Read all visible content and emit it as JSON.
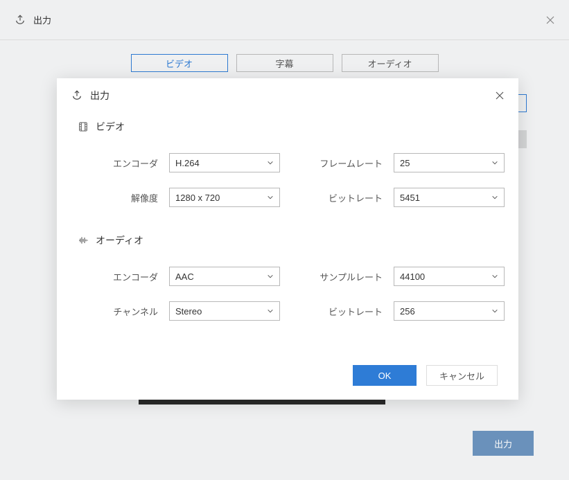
{
  "background": {
    "title": "出力",
    "tabs": {
      "video": "ビデオ",
      "subtitles": "字幕",
      "audio": "オーディオ"
    },
    "output_button": "出力"
  },
  "modal": {
    "title": "出力",
    "video_section": {
      "title": "ビデオ",
      "encoder_label": "エンコーダ",
      "encoder_value": "H.264",
      "resolution_label": "解像度",
      "resolution_value": "1280 x 720",
      "framerate_label": "フレームレート",
      "framerate_value": "25",
      "bitrate_label": "ビットレート",
      "bitrate_value": "5451"
    },
    "audio_section": {
      "title": "オーディオ",
      "encoder_label": "エンコーダ",
      "encoder_value": "AAC",
      "channel_label": "チャンネル",
      "channel_value": "Stereo",
      "samplerate_label": "サンプルレート",
      "samplerate_value": "44100",
      "bitrate_label": "ビットレート",
      "bitrate_value": "256"
    },
    "ok": "OK",
    "cancel": "キャンセル"
  }
}
